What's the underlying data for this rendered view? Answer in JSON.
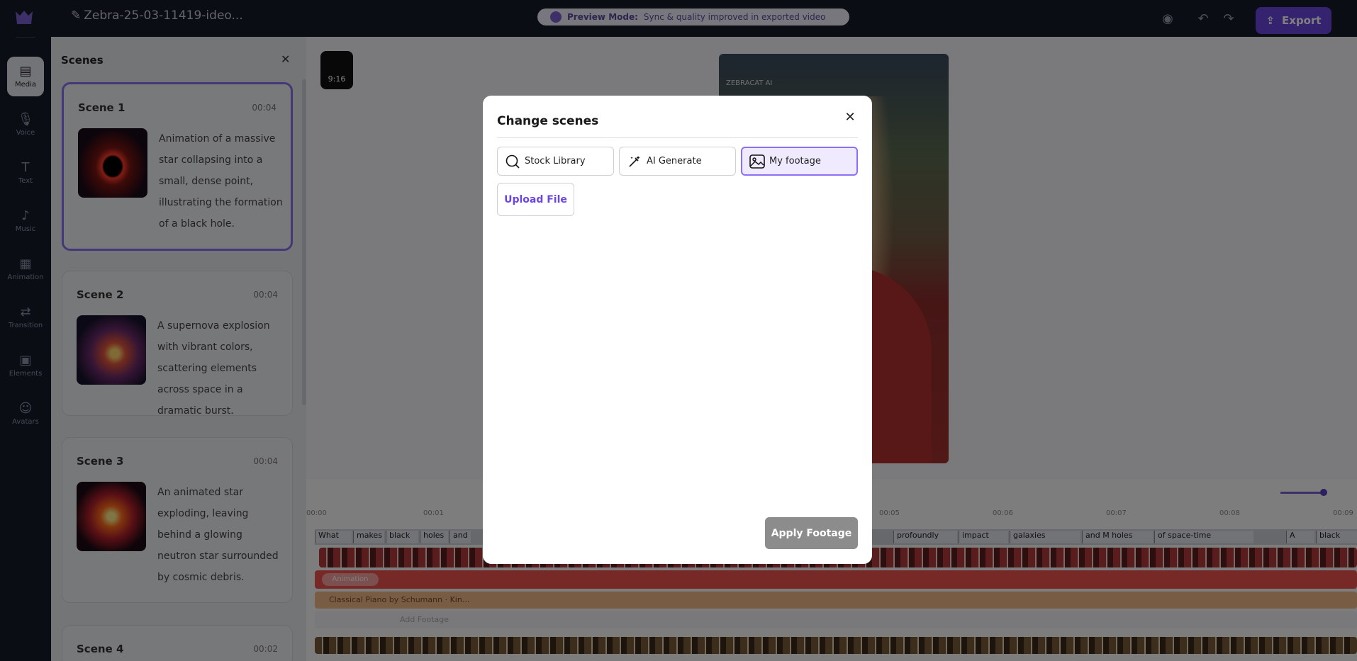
{
  "app": {
    "project_title": "Zebra-25-03-11419-ideo...",
    "preview_banner": {
      "title": "Preview Mode:",
      "text": "Sync & quality improved in exported video"
    },
    "export_label": "Export"
  },
  "left_nav": {
    "items": [
      {
        "label": "Media",
        "icon": "media-icon"
      },
      {
        "label": "Voice",
        "icon": "mic-icon"
      },
      {
        "label": "Text",
        "icon": "text-icon"
      },
      {
        "label": "Music",
        "icon": "music-icon"
      },
      {
        "label": "Animation",
        "icon": "animation-icon"
      },
      {
        "label": "Transition",
        "icon": "transition-icon"
      },
      {
        "label": "Elements",
        "icon": "elements-icon"
      },
      {
        "label": "Avatars",
        "icon": "avatar-icon"
      }
    ]
  },
  "scenes_panel": {
    "title": "Scenes",
    "scenes": [
      {
        "title": "Scene 1",
        "time": "00:04",
        "description": "Animation of a massive star collapsing into a small, dense point, illustrating the formation of a black hole."
      },
      {
        "title": "Scene 2",
        "time": "00:04",
        "description": "A supernova explosion with vibrant colors, scattering elements across space in a dramatic burst."
      },
      {
        "title": "Scene 3",
        "time": "00:04",
        "description": "An animated star exploding, leaving behind a glowing neutron star surrounded by cosmic debris."
      },
      {
        "title": "Scene 4",
        "time": "00:02",
        "description": ""
      }
    ]
  },
  "canvas": {
    "aspect_ratio": "9:16",
    "watermark": "ZEBRACAT AI"
  },
  "timeline": {
    "ruler": [
      "00:00",
      "00:01",
      "00:05",
      "00:06",
      "00:07",
      "00:08",
      "00:09"
    ],
    "words": [
      "What",
      "makes",
      "black",
      "holes",
      "and",
      "profoundly",
      "impact",
      "galaxies",
      "and M holes",
      "of space-time",
      "A",
      "black"
    ],
    "red_chip": "Animation",
    "audio_track": "Classical Piano by Schumann · Kin...",
    "empty_track": "Add Footage"
  },
  "modal": {
    "title": "Change scenes",
    "tabs": [
      {
        "label": "Stock Library",
        "icon": "search-icon"
      },
      {
        "label": "AI Generate",
        "icon": "magic-wand-icon"
      },
      {
        "label": "My footage",
        "icon": "image-icon"
      }
    ],
    "active_tab": "My footage",
    "upload_label": "Upload File",
    "apply_label": "Apply Footage"
  },
  "colors": {
    "accent": "#6b46e0",
    "active_border": "#8c6ff2",
    "dark_bg": "#171b29"
  }
}
